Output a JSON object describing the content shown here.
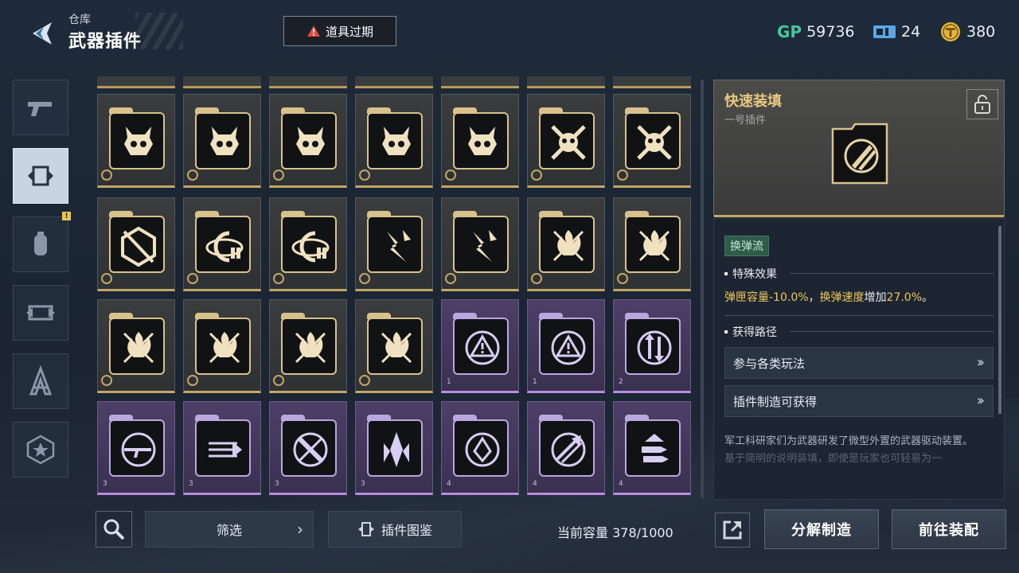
{
  "header": {
    "subtitle": "仓库",
    "title": "武器插件",
    "expire_label": "道具过期"
  },
  "currency": {
    "gp_icon": "GP",
    "gp_value": "59736",
    "tickets_value": "24",
    "coins_value": "380"
  },
  "left_tabs": [
    "pistol-icon",
    "plugin-icon",
    "grenade-icon",
    "weapon-swap-icon",
    "compass-icon",
    "star-badge-icon"
  ],
  "grid": {
    "row1": [
      "demon-skull-icon",
      "demon-skull-icon",
      "demon-skull-icon",
      "demon-skull-icon",
      "demon-skull-icon",
      "crossed-skull-icon",
      "crossed-skull-icon"
    ],
    "row2": [
      "slash-hexagon-icon",
      "ammo-orbit-icon",
      "ammo-orbit-icon",
      "shatter-icon",
      "shatter-icon",
      "flame-burst-icon",
      "flame-burst-icon"
    ],
    "row3": [
      "flame-burst-icon",
      "flame-burst-icon",
      "flame-burst-icon",
      "flame-burst-icon",
      "warning-cycle-icon",
      "warning-cycle-icon",
      "arrow-cycle-icon"
    ],
    "row4": [
      "rifle-cycle-icon",
      "triple-arrow-icon",
      "crossed-shell-icon",
      "diamond-burst-icon",
      "target-drop-icon",
      "speed-arrow-icon",
      "shell-stack-icon"
    ],
    "row3_levels": [
      "",
      "",
      "",
      "",
      "1",
      "1",
      "2"
    ],
    "row4_levels": [
      "3",
      "3",
      "3",
      "3",
      "4",
      "4",
      "4"
    ]
  },
  "bottom": {
    "filter_label": "筛选",
    "codex_label": "插件图鉴",
    "capacity": "当前容量 378/1000",
    "disassemble_label": "分解制造",
    "equip_label": "前往装配"
  },
  "detail": {
    "name": "快速装填",
    "type": "一号插件",
    "tag": "换弹流",
    "effect_title": "特殊效果",
    "effect_parts": [
      "弹匣容量",
      "-10.0%",
      "，",
      "换弹速度",
      "增加",
      "27.0%",
      "。"
    ],
    "route_title": "获得路径",
    "routes": [
      "参与各类玩法",
      "插件制造可获得"
    ],
    "description": "军工科研家们为武器研发了微型外置的武器驱动装置。",
    "description_faded": "基于简明的说明装填，即使是玩家也可轻易为一"
  },
  "colors": {
    "gold": "#c5a666",
    "purple": "#b78de0",
    "accent_yellow": "#f1c75a"
  }
}
